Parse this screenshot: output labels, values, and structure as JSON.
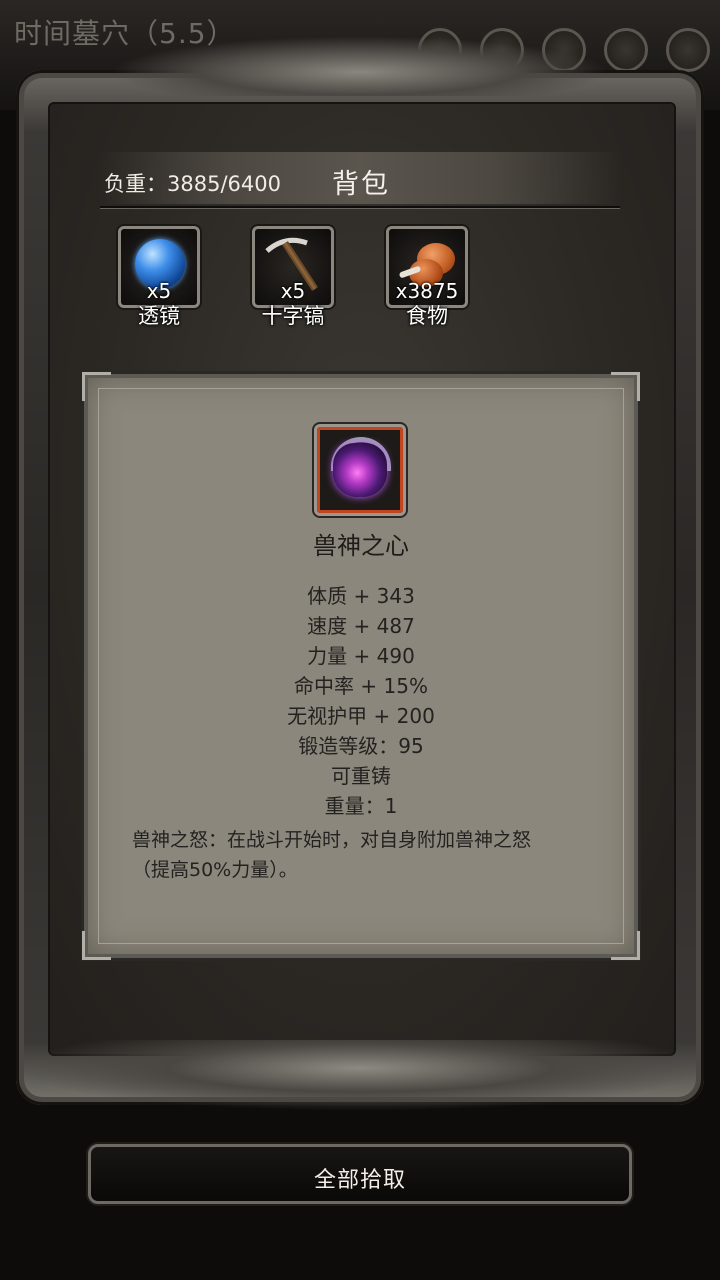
{
  "background": {
    "title": "时间墓穴（5.5）",
    "subtitle": "",
    "top_icons": [
      "round-icon-1",
      "round-icon-2",
      "round-icon-3",
      "round-icon-4",
      "gear-icon"
    ]
  },
  "bag": {
    "weight": "负重：3885/6400",
    "title": "背包",
    "items": [
      {
        "name": "透镜",
        "count": "x5",
        "icon": "lens-icon"
      },
      {
        "name": "十字镐",
        "count": "x5",
        "icon": "pickaxe-icon"
      },
      {
        "name": "食物",
        "count": "x3875",
        "icon": "food-icon"
      }
    ]
  },
  "detail": {
    "icon": "beast-heart-icon",
    "name": "兽神之心",
    "stats": [
      "体质 + 343",
      "速度 + 487",
      "力量 + 490",
      "命中率 + 15%",
      "无视护甲 + 200",
      "锻造等级：95",
      "可重铸",
      "重量：1"
    ],
    "description_line1": "兽神之怒：在战斗开始时，对自身附加兽神之怒",
    "description_line2": "（提高50%力量）。"
  },
  "actions": {
    "pickup_all": "全部拾取"
  },
  "colors": {
    "panel": "#8c877c",
    "frame": "#3b3936",
    "rarity_border": "#c2451f"
  }
}
